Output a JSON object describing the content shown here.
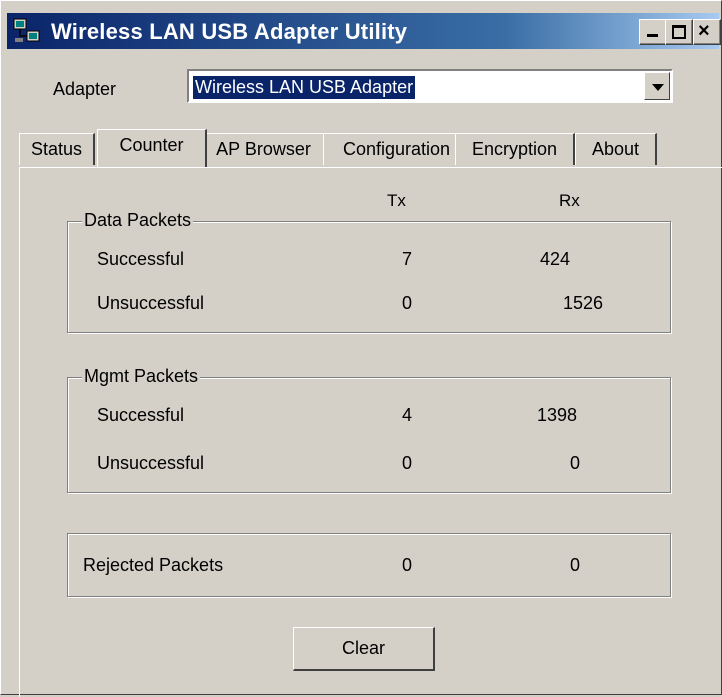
{
  "window": {
    "title": "Wireless LAN USB Adapter Utility"
  },
  "adapter": {
    "label": "Adapter",
    "selected": "Wireless LAN USB Adapter"
  },
  "tabs": [
    {
      "label": "Status"
    },
    {
      "label": "Counter",
      "active": true
    },
    {
      "label": "AP Browser"
    },
    {
      "label": "Configuration"
    },
    {
      "label": "Encryption"
    },
    {
      "label": "About"
    }
  ],
  "columns": {
    "tx": "Tx",
    "rx": "Rx"
  },
  "data_packets": {
    "title": "Data Packets",
    "successful": {
      "label": "Successful",
      "tx": "7",
      "rx": "424"
    },
    "unsuccessful": {
      "label": "Unsuccessful",
      "tx": "0",
      "rx": "1526"
    }
  },
  "mgmt_packets": {
    "title": "Mgmt Packets",
    "successful": {
      "label": "Successful",
      "tx": "4",
      "rx": "1398"
    },
    "unsuccessful": {
      "label": "Unsuccessful",
      "tx": "0",
      "rx": "0"
    }
  },
  "rejected": {
    "label": "Rejected Packets",
    "tx": "0",
    "rx": "0"
  },
  "buttons": {
    "clear": "Clear"
  }
}
